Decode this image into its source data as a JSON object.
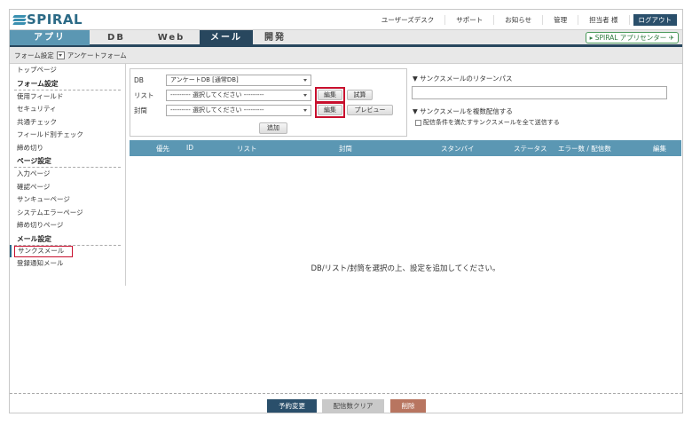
{
  "header": {
    "logo_text": "SPIRAL",
    "links": [
      "ユーザーズデスク",
      "サポート",
      "お知らせ",
      "管理",
      "担当者 様"
    ],
    "logout_label": "ログアウト"
  },
  "nav": {
    "tabs": [
      "アプリ",
      "DB",
      "Web",
      "メール",
      "開発"
    ],
    "app_center_label": "▸ SPIRAL アプリセンター"
  },
  "breadcrumb": {
    "section": "フォーム設定",
    "current": "アンケートフォーム"
  },
  "sidebar": {
    "top_item": "トップページ",
    "groups": [
      {
        "title": "フォーム設定",
        "items": [
          "使用フィールド",
          "セキュリティ",
          "共通チェック",
          "フィールド別チェック",
          "締め切り"
        ]
      },
      {
        "title": "ページ設定",
        "items": [
          "入力ページ",
          "確認ページ",
          "サンキューページ",
          "システムエラーページ",
          "締め切りページ"
        ]
      },
      {
        "title": "メール設定",
        "items": [
          "サンクスメール",
          "登録通知メール"
        ]
      }
    ],
    "active_item": "サンクスメール"
  },
  "form": {
    "db_label": "DB",
    "db_value": "アンケートDB [通常DB]",
    "list_label": "リスト",
    "list_value": "--------- 選択してください ---------",
    "envelope_label": "封筒",
    "envelope_value": "--------- 選択してください ---------",
    "edit_label": "編集",
    "test_label": "試算",
    "preview_label": "プレビュー",
    "add_label": "追加"
  },
  "right": {
    "return_path_title": "▼ サンクスメールのリターンパス",
    "return_path_value": "",
    "multi_title": "▼ サンクスメールを複数配信する",
    "multi_checkbox_label": "配信条件を満たすサンクスメールを全て送信する"
  },
  "table": {
    "columns": [
      "優先",
      "ID",
      "リスト",
      "封筒",
      "スタンバイ",
      "ステータス",
      "エラー数 / 配信数",
      "編集"
    ],
    "empty_message": "DB/リスト/封筒を選択の上、設定を追加してください。"
  },
  "footer": {
    "reserve_label": "予約変更",
    "clear_label": "配信数クリア",
    "delete_label": "削除"
  },
  "colors": {
    "nav_dark": "#28475e",
    "nav_light": "#5b97b3",
    "highlight": "#c8102e",
    "delete": "#b87560"
  }
}
